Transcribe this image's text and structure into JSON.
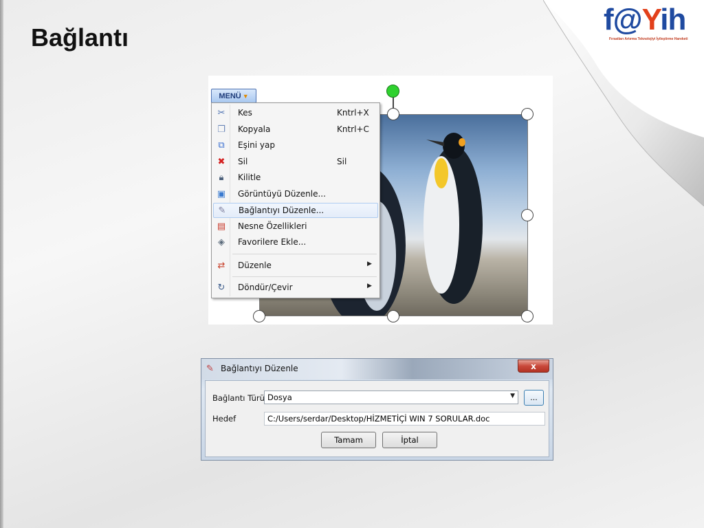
{
  "slide": {
    "title": "Bağlantı"
  },
  "logo": {
    "word_start": "f@",
    "word_end": "ih",
    "subtitle": "Fırsatları Artırma Teknolojiyi İyileştirme Hareketi",
    "colors": {
      "blue": "#1f4aa0",
      "red": "#e2401b"
    }
  },
  "context_menu": {
    "button_label": "MENÜ",
    "items": [
      {
        "label": "Kes",
        "shortcut": "Kntrl+X",
        "icon": "scissors-icon"
      },
      {
        "label": "Kopyala",
        "shortcut": "Kntrl+C",
        "icon": "copy-icon"
      },
      {
        "label": "Eşini yap",
        "shortcut": "",
        "icon": "duplicate-icon"
      },
      {
        "label": "Sil",
        "shortcut": "Sil",
        "icon": "delete-x-icon"
      },
      {
        "label": "Kilitle",
        "shortcut": "",
        "icon": "lock-icon"
      },
      {
        "label": "Görüntüyü Düzenle...",
        "shortcut": "",
        "icon": "edit-image-icon"
      },
      {
        "label": "Bağlantıyı Düzenle...",
        "shortcut": "",
        "icon": "link-icon",
        "highlighted": true
      },
      {
        "label": "Nesne Özellikleri",
        "shortcut": "",
        "icon": "properties-icon"
      },
      {
        "label": "Favorilere Ekle...",
        "shortcut": "",
        "icon": "favorites-icon"
      },
      {
        "label": "Düzenle",
        "shortcut": "",
        "icon": "arrange-icon",
        "submenu": true
      },
      {
        "label": "Döndür/Çevir",
        "shortcut": "",
        "icon": "rotate-icon",
        "submenu": true
      }
    ]
  },
  "dialog": {
    "title": "Bağlantıyı Düzenle",
    "close_label": "x",
    "link_type_label": "Bağlantı Türü",
    "link_type_value": "Dosya",
    "browse_label": "...",
    "target_label": "Hedef",
    "target_value": "C:/Users/serdar/Desktop/HİZMETİÇİ WIN 7 SORULAR.doc",
    "ok_label": "Tamam",
    "cancel_label": "İptal"
  }
}
